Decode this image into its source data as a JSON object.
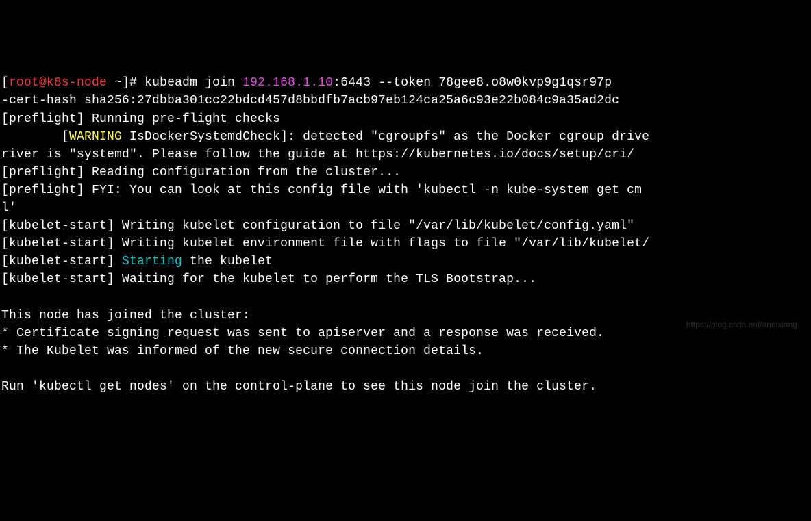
{
  "prompt": {
    "user": "root",
    "host": "k8s-node",
    "cwd": "~",
    "symbol": "#"
  },
  "command": {
    "cmd": "kubeadm join ",
    "ip": "192.168.1.10",
    "port": ":6443",
    "flags_rest": " --token 78gee8.o8w0kvp9g1qsr97p",
    "line2": "-cert-hash sha256:27dbba301cc22bdcd457d8bbdfb7acb97eb124ca25a6c93e22b084c9a35ad2dc"
  },
  "output": {
    "preflight1": "[preflight] Running pre-flight checks",
    "warn_indent": "        [",
    "warn_tag": "WARNING",
    "warn_rest": " IsDockerSystemdCheck]: detected \"cgroupfs\" as the Docker cgroup drive",
    "river_line": "river is \"systemd\". Please follow the guide at https://kubernetes.io/docs/setup/cri/",
    "preflight2": "[preflight] Reading configuration from the cluster...",
    "preflight3": "[preflight] FYI: You can look at this config file with 'kubectl -n kube-system get cm",
    "preflight3b": "l'",
    "ks1": "[kubelet-start] Writing kubelet configuration to file \"/var/lib/kubelet/config.yaml\"",
    "ks2": "[kubelet-start] Writing kubelet environment file with flags to file \"/var/lib/kubelet/",
    "ks3_prefix": "[kubelet-start] ",
    "ks3_starting": "Starting",
    "ks3_suffix": " the kubelet",
    "ks4": "[kubelet-start] Waiting for the kubelet to perform the TLS Bootstrap...",
    "joined_header": "This node has joined the cluster:",
    "joined_b1": "* Certificate signing request was sent to apiserver and a response was received.",
    "joined_b2": "* The Kubelet was informed of the new secure connection details.",
    "final": "Run 'kubectl get nodes' on the control-plane to see this node join the cluster."
  },
  "watermark": "https://blog.csdn.net/anqixiang"
}
